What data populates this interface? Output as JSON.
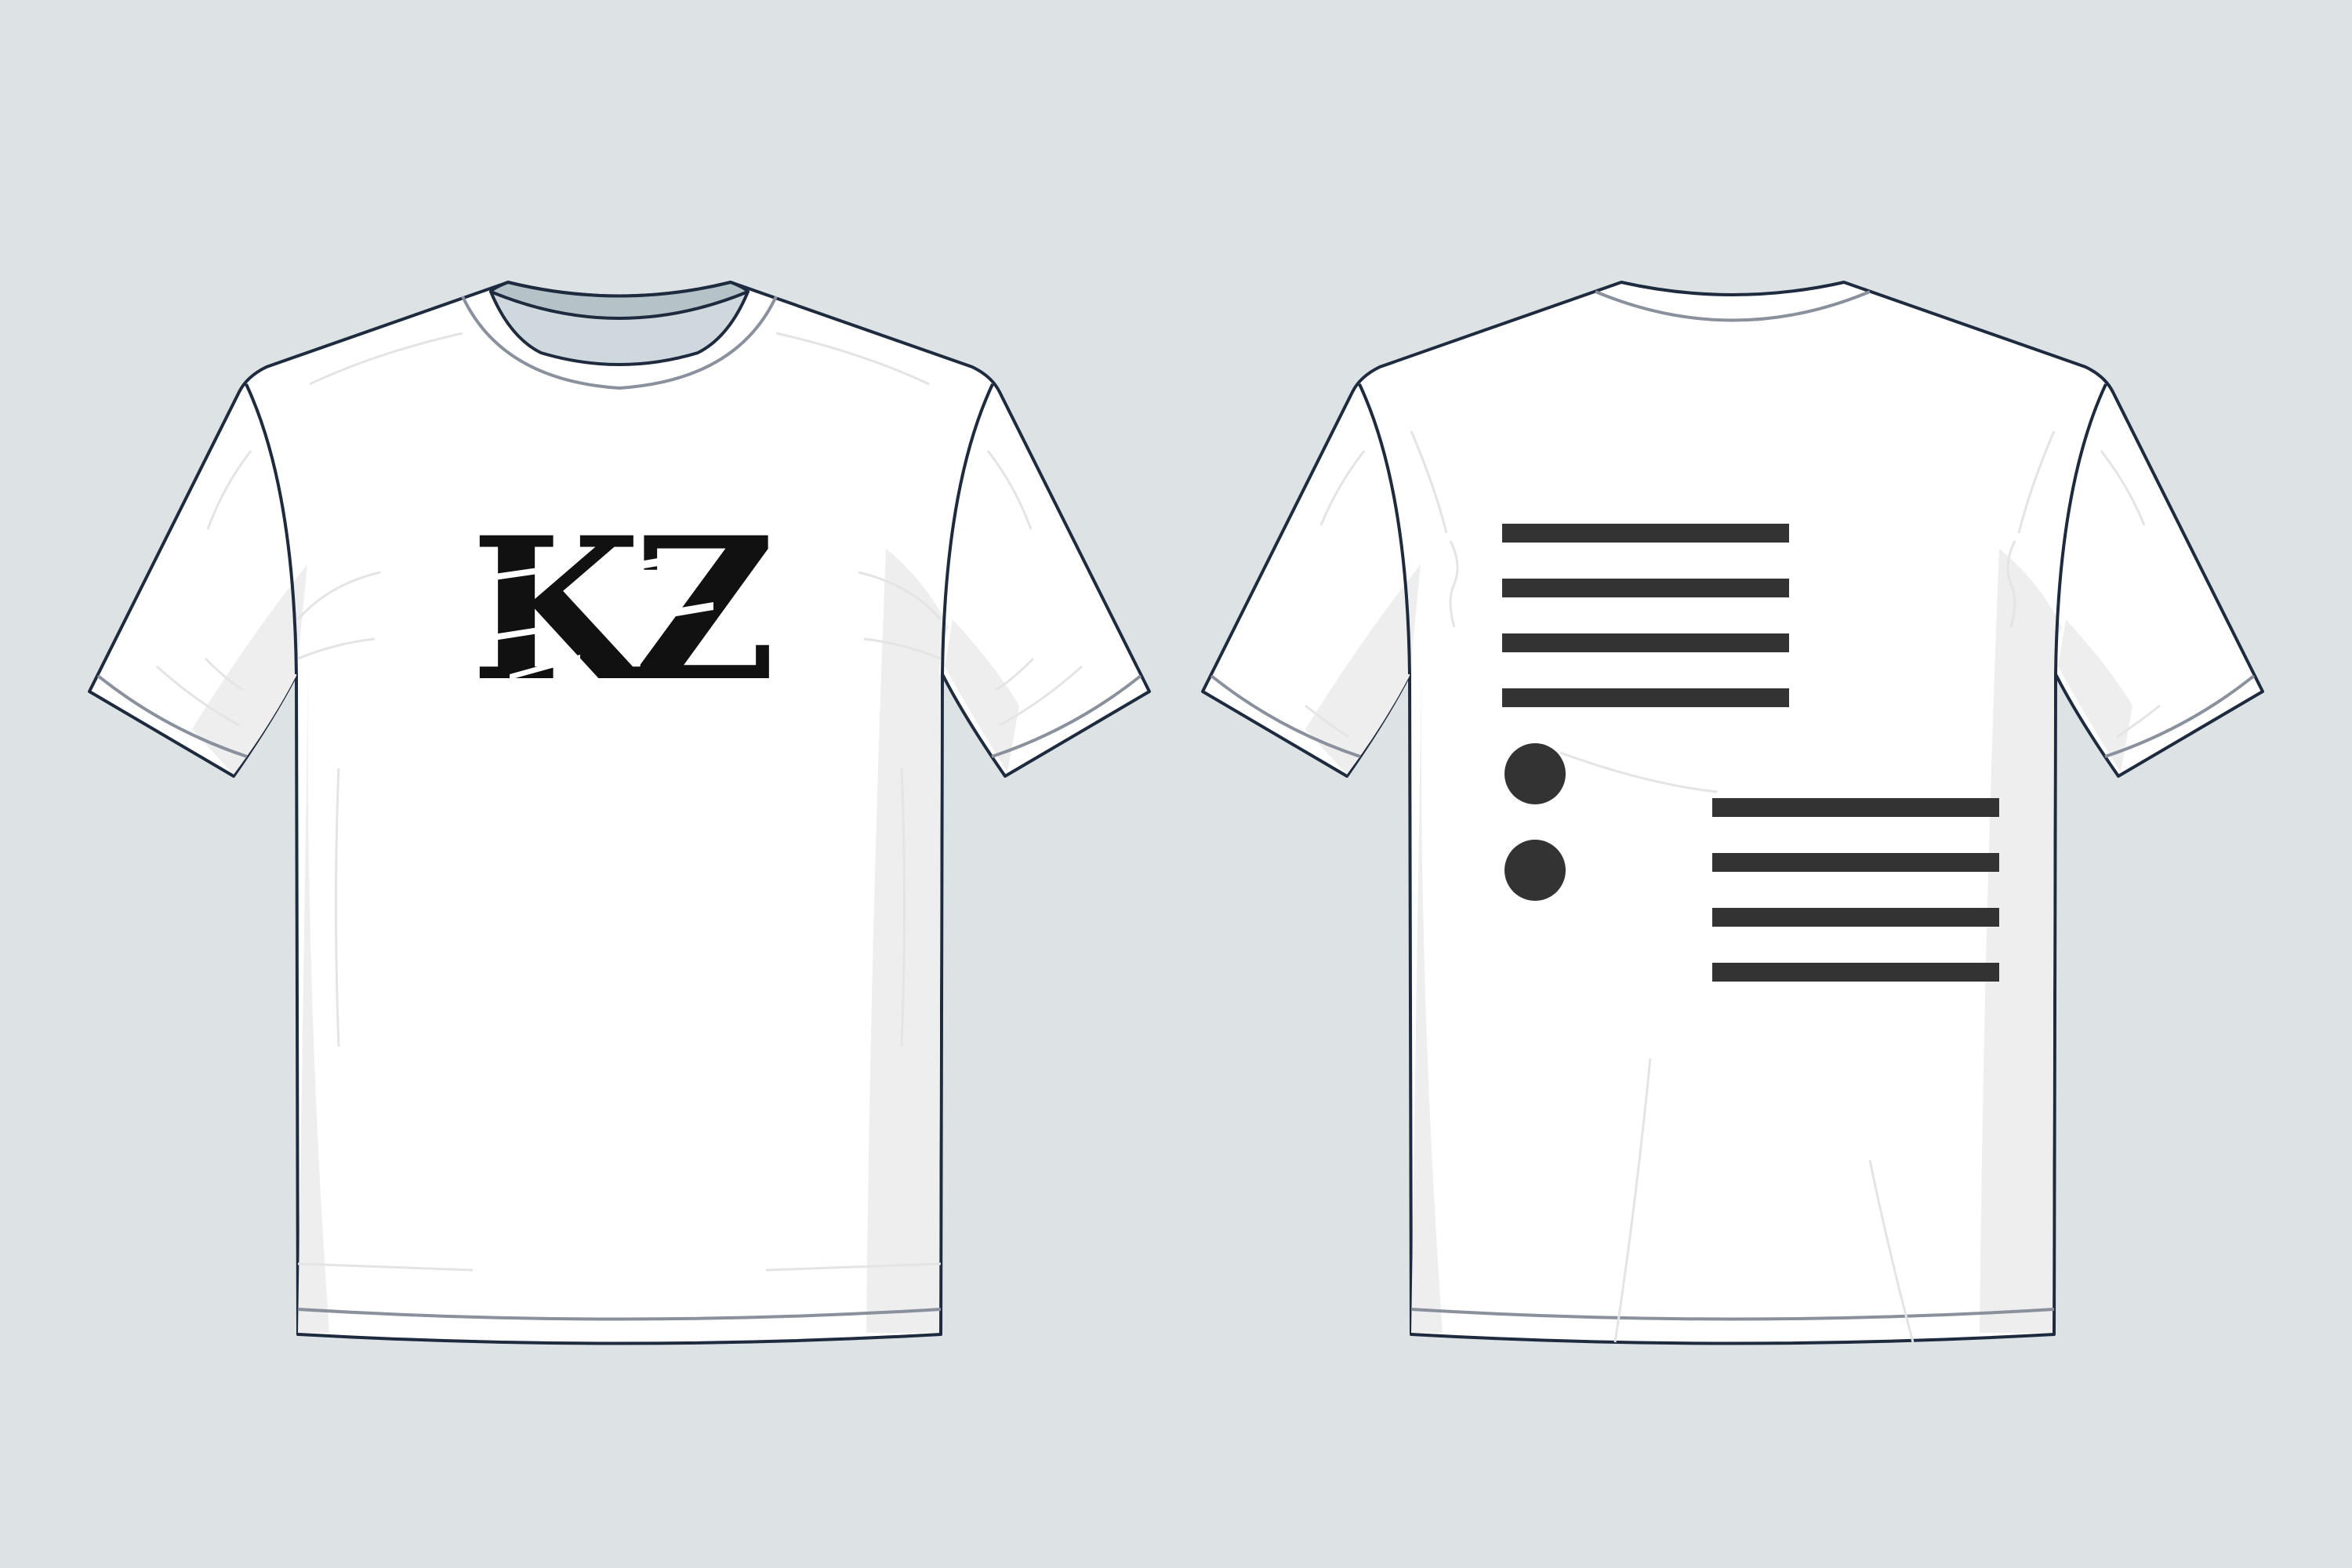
{
  "background_color": "#DDE2E5",
  "shirt_color": "#FFFFFF",
  "outline_color": "#1E2A3E",
  "collar_inner_color": "#CFD8DC",
  "shading_color": "#EEEEEE",
  "front": {
    "view": "front",
    "logo_text": "KZ",
    "logo_color": "#111111"
  },
  "back": {
    "view": "back",
    "print_color": "#333333",
    "print_icon": "list-with-bullets-icon",
    "upper_bar_count": 4,
    "lower_bar_count": 4,
    "bullet_count": 2
  }
}
